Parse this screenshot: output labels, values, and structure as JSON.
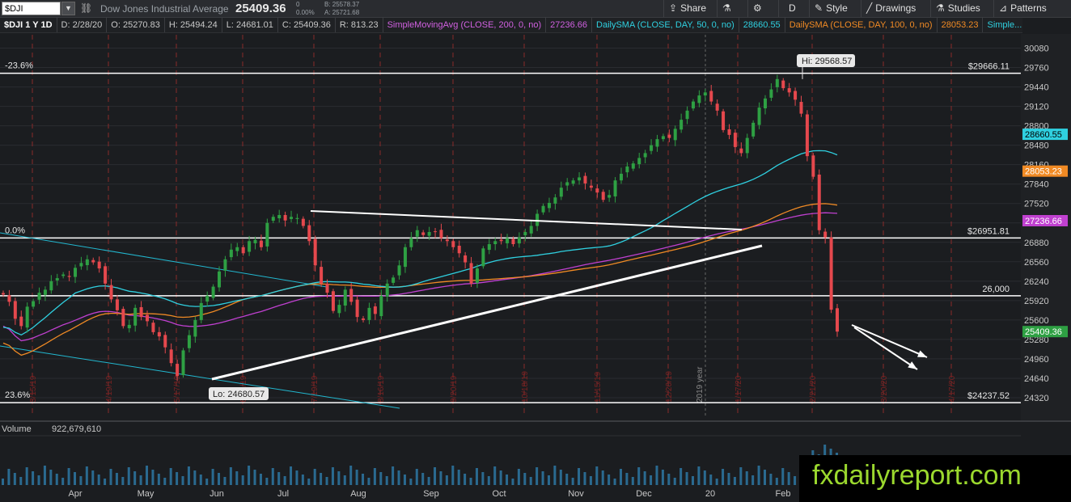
{
  "toolbar": {
    "symbol": "$DJI",
    "name": "Dow Jones Industrial Average",
    "last": "25409.36",
    "change": "0",
    "change_pct": "0.00%",
    "bid": "B: 25578.37",
    "ask": "A: 25721.68",
    "buttons": [
      {
        "label": "Share",
        "icon": "share-icon"
      },
      {
        "label": "",
        "icon": "flask-icon"
      },
      {
        "label": "",
        "icon": "gear-icon"
      },
      {
        "label": "D",
        "icon": ""
      },
      {
        "label": "Style",
        "icon": "style-icon"
      },
      {
        "label": "Drawings",
        "icon": "pencil-icon"
      },
      {
        "label": "Studies",
        "icon": "studies-icon"
      },
      {
        "label": "Patterns",
        "icon": "patterns-icon"
      }
    ]
  },
  "header": {
    "symbol_period": "$DJI 1 Y 1D",
    "date": "D: 2/28/20",
    "open": "O: 25270.83",
    "high": "H: 25494.24",
    "low": "L: 24681.01",
    "close": "C: 25409.36",
    "range": "R: 813.23",
    "sma200": "SimpleMovingAvg (CLOSE, 200, 0, no)",
    "sma200_val": "27236.66",
    "sma50": "DailySMA (CLOSE, DAY, 50, 0, no)",
    "sma50_val": "28660.55",
    "sma100": "DailySMA (CLOSE, DAY, 100, 0, no)",
    "sma100_val": "28053.23",
    "more": "Simple..."
  },
  "colors": {
    "up": "#2ea043",
    "down": "#e5484d",
    "sma50": "#2fd0e0",
    "sma100": "#f08a24",
    "sma200": "#c040d0",
    "trend": "#ffffff",
    "channel": "#22b8d0"
  },
  "volume": {
    "label": "Volume",
    "value": "922,679,610"
  },
  "watermark": "fxdailyreport.com",
  "chart_data": {
    "type": "candlestick",
    "y_range": [
      24000,
      30300
    ],
    "y_ticks": [
      30080,
      29760,
      29440,
      29120,
      28800,
      28480,
      28160,
      27840,
      27520,
      27200,
      26880,
      26560,
      26240,
      25920,
      25600,
      25280,
      24960,
      24640,
      24320
    ],
    "x_labels": [
      "Apr",
      "May",
      "Jun",
      "Jul",
      "Aug",
      "Sep",
      "Oct",
      "Nov",
      "Dec",
      "20",
      "Feb"
    ],
    "vertical_markers": [
      "3/15/19",
      "4/19/19",
      "5/17/19",
      "6/21/19",
      "7/19/19",
      "8/16/19",
      "9/20/19",
      "10/18/19",
      "11/15/19",
      "12/20/19",
      "1/17/20",
      "2/21/20",
      "3/20/20",
      "4/17/20"
    ],
    "year_marker": "2019 year",
    "price_levels": [
      {
        "label": "-23.6%",
        "price_label": "$29666.11",
        "value": 29666.11
      },
      {
        "label": "0.0%",
        "price_label": "$26951.81",
        "value": 26951.81
      },
      {
        "label": "",
        "price_label": "26,000",
        "value": 26000
      },
      {
        "label": "23.6%",
        "price_label": "$24237.52",
        "value": 24237.52
      }
    ],
    "annotations": [
      {
        "text": "Hi: 29568.57",
        "value": 29568.57
      },
      {
        "text": "Lo: 24680.57",
        "value": 24680.57
      }
    ],
    "price_badges": [
      {
        "text": "28660.55",
        "value": 28660.55,
        "series": "sma50"
      },
      {
        "text": "28053.23",
        "value": 28053.23,
        "series": "sma100"
      },
      {
        "text": "27236.66",
        "value": 27236.66,
        "series": "sma200"
      },
      {
        "text": "25409.36",
        "value": 25409.36,
        "series": "last"
      }
    ],
    "closes": [
      26020,
      25900,
      25620,
      25500,
      25820,
      25910,
      26050,
      26100,
      26240,
      26290,
      26350,
      26310,
      26460,
      26540,
      26600,
      26550,
      26450,
      26200,
      25940,
      25760,
      25500,
      25520,
      25800,
      25650,
      25580,
      25400,
      25330,
      25150,
      24890,
      24680,
      25100,
      25350,
      25600,
      25880,
      26000,
      26150,
      26400,
      26600,
      26760,
      26800,
      26700,
      26900,
      26920,
      26800,
      27200,
      27300,
      27330,
      27240,
      27300,
      27280,
      27150,
      26900,
      26500,
      26200,
      26050,
      25750,
      25850,
      26100,
      25900,
      25650,
      25600,
      25800,
      25700,
      26000,
      26200,
      26300,
      26500,
      26800,
      26950,
      27080,
      27000,
      27050,
      27050,
      26950,
      26900,
      26800,
      26700,
      26550,
      26200,
      26450,
      26780,
      26850,
      26900,
      26900,
      26950,
      26850,
      26960,
      27050,
      27150,
      27350,
      27480,
      27530,
      27620,
      27780,
      27870,
      27900,
      27950,
      27850,
      27780,
      27700,
      27580,
      27660,
      27900,
      28010,
      28130,
      28180,
      28270,
      28350,
      28480,
      28580,
      28630,
      28600,
      28750,
      28900,
      29050,
      29200,
      29300,
      29350,
      29200,
      29050,
      28730,
      28650,
      28450,
      28350,
      28600,
      28850,
      29100,
      29250,
      29400,
      29570,
      29420,
      29350,
      29230,
      29000,
      28300,
      27960,
      27080,
      26960,
      25770,
      25409
    ]
  }
}
